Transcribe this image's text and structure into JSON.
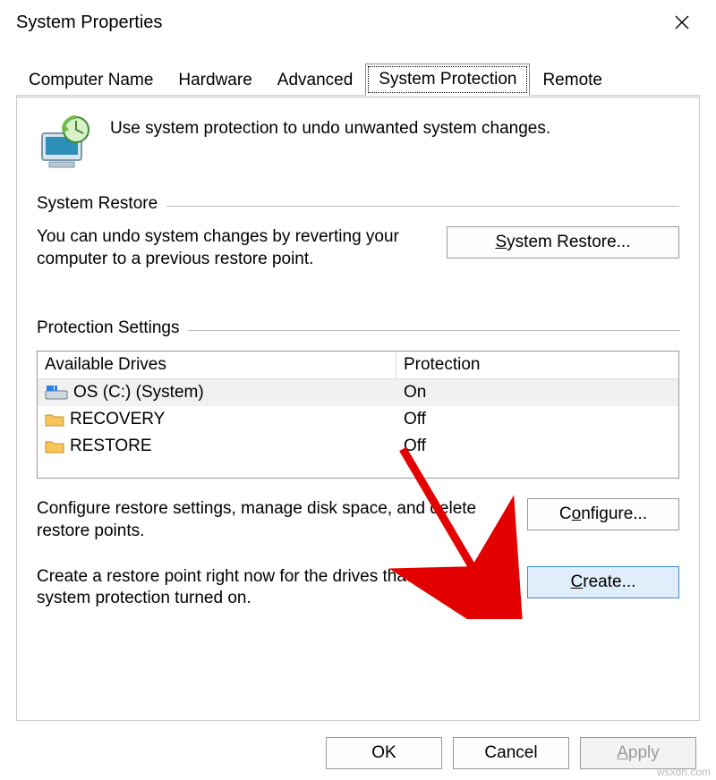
{
  "window": {
    "title": "System Properties",
    "close_icon": "✕"
  },
  "tabs": {
    "t0": "Computer Name",
    "t1": "Hardware",
    "t2": "Advanced",
    "t3": "System Protection",
    "t4": "Remote"
  },
  "intro": "Use system protection to undo unwanted system changes.",
  "group_restore": {
    "title": "System Restore",
    "desc": "You can undo system changes by reverting your computer to a previous restore point.",
    "button_prefix": "S",
    "button_rest": "ystem Restore..."
  },
  "group_protection": {
    "title": "Protection Settings",
    "col_drive": "Available Drives",
    "col_prot": "Protection",
    "drives": [
      {
        "name": "OS (C:) (System)",
        "protection": "On",
        "type": "disk",
        "selected": true
      },
      {
        "name": "RECOVERY",
        "protection": "Off",
        "type": "folder",
        "selected": false
      },
      {
        "name": "RESTORE",
        "protection": "Off",
        "type": "folder",
        "selected": false
      }
    ],
    "configure_desc": "Configure restore settings, manage disk space, and delete restore points.",
    "configure_prefix": "C",
    "configure_rest": "onfigure...",
    "create_desc": "Create a restore point right now for the drives that have system protection turned on.",
    "create_prefix": "C",
    "create_rest": "reate..."
  },
  "footer": {
    "ok": "OK",
    "cancel": "Cancel",
    "apply_prefix": "A",
    "apply_rest": "pply"
  },
  "watermark": "wsxdn.com"
}
